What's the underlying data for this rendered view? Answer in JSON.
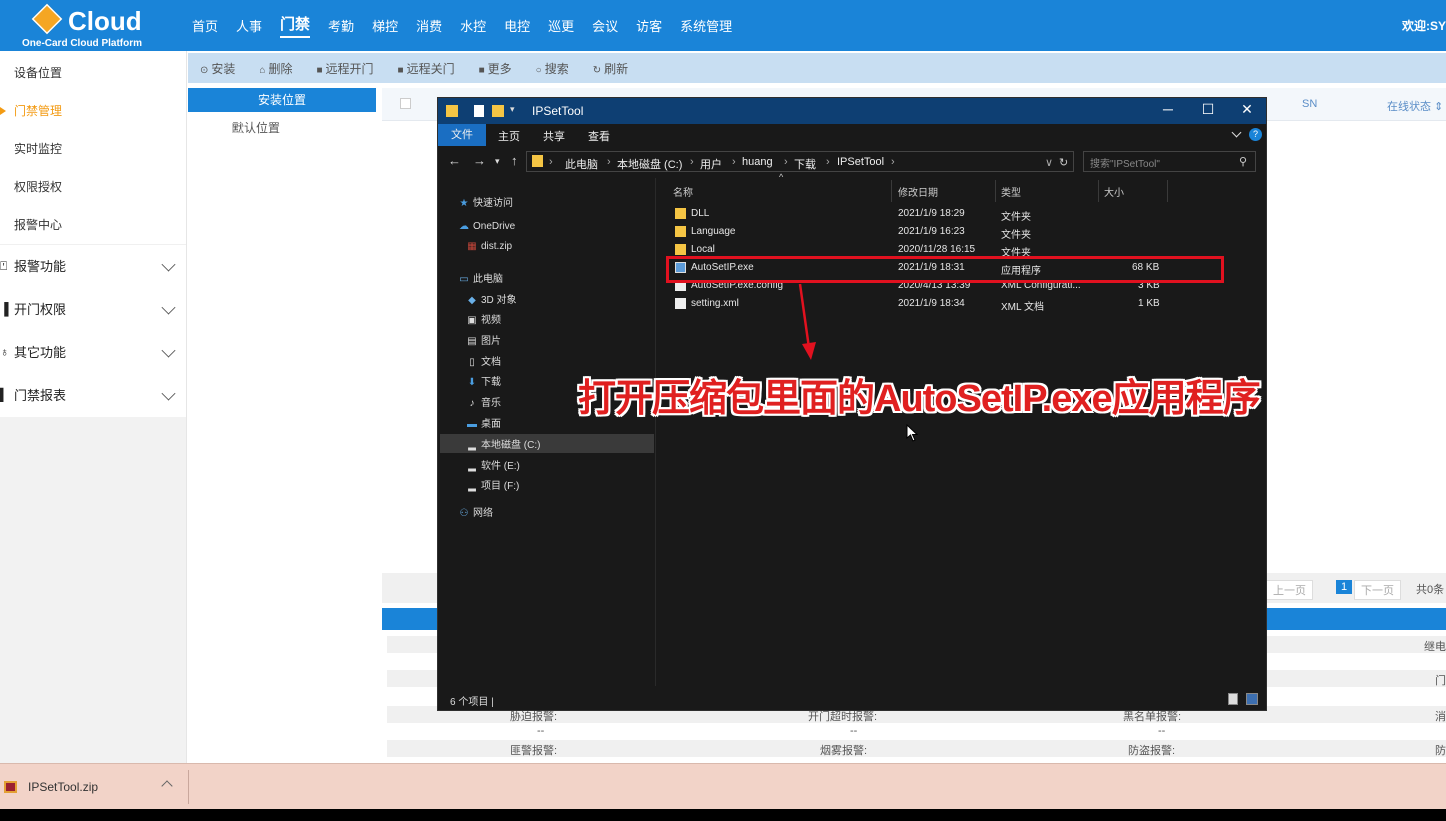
{
  "brand": {
    "name": "Cloud",
    "subtitle": "One-Card Cloud Platform"
  },
  "topnav": [
    "首页",
    "人事",
    "门禁",
    "考勤",
    "梯控",
    "消费",
    "水控",
    "电控",
    "巡更",
    "会议",
    "访客",
    "系统管理"
  ],
  "topnav_active": "门禁",
  "welcome": "欢迎:SY",
  "sidebar": {
    "items": [
      "设备位置",
      "门禁管理",
      "实时监控",
      "权限授权",
      "报警中心"
    ],
    "active": "门禁管理",
    "groups": [
      "报警功能",
      "开门权限",
      "其它功能",
      "门禁报表"
    ]
  },
  "toolbar": [
    "安装",
    "删除",
    "远程开门",
    "远程关门",
    "更多",
    "搜索",
    "刷新"
  ],
  "tree": {
    "header": "安装位置",
    "node": "默认位置"
  },
  "grid": {
    "col_sn": "SN",
    "col_online": "在线状态"
  },
  "pager": {
    "prev": "上一页",
    "current": "1",
    "next": "下一页",
    "total": "共0条"
  },
  "details": {
    "row3": [
      "胁迫报警:",
      "开门超时报警:",
      "黑名单报警:",
      "消"
    ],
    "row4": [
      "--",
      "--",
      "--"
    ],
    "row5": [
      "匪警报警:",
      "烟雾报警:",
      "防盗报警:",
      "防"
    ],
    "right1": "继电",
    "right2": "门"
  },
  "taskbar": {
    "file": "IPSetTool.zip"
  },
  "explorer": {
    "title": "IPSetTool",
    "ribbon": [
      "文件",
      "主页",
      "共享",
      "查看"
    ],
    "breadcrumb": [
      "此电脑",
      "本地磁盘 (C:)",
      "用户",
      "huang",
      "下载",
      "IPSetTool"
    ],
    "search_placeholder": "搜索\"IPSetTool\"",
    "nav": [
      {
        "label": "快速访问",
        "icon": "star-icon"
      },
      {
        "label": "OneDrive",
        "icon": "cloud-icon"
      },
      {
        "label": "dist.zip",
        "icon": "zip-icon"
      },
      {
        "label": "此电脑",
        "icon": "pc-icon"
      },
      {
        "label": "3D 对象",
        "icon": "cube-icon"
      },
      {
        "label": "视频",
        "icon": "video-icon"
      },
      {
        "label": "图片",
        "icon": "picture-icon"
      },
      {
        "label": "文档",
        "icon": "document-icon"
      },
      {
        "label": "下载",
        "icon": "download-icon"
      },
      {
        "label": "音乐",
        "icon": "music-icon"
      },
      {
        "label": "桌面",
        "icon": "desktop-icon"
      },
      {
        "label": "本地磁盘 (C:)",
        "icon": "drive-icon"
      },
      {
        "label": "软件 (E:)",
        "icon": "drive-icon"
      },
      {
        "label": "项目 (F:)",
        "icon": "drive-icon"
      },
      {
        "label": "网络",
        "icon": "network-icon"
      }
    ],
    "columns": [
      "名称",
      "修改日期",
      "类型",
      "大小"
    ],
    "files": [
      {
        "name": "DLL",
        "date": "2021/1/9 18:29",
        "type": "文件夹",
        "size": "",
        "icon": "folder-icon"
      },
      {
        "name": "Language",
        "date": "2021/1/9 16:23",
        "type": "文件夹",
        "size": "",
        "icon": "folder-icon"
      },
      {
        "name": "Local",
        "date": "2020/11/28 16:15",
        "type": "文件夹",
        "size": "",
        "icon": "folder-icon"
      },
      {
        "name": "AutoSetIP.exe",
        "date": "2021/1/9 18:31",
        "type": "应用程序",
        "size": "68 KB",
        "icon": "exe-icon"
      },
      {
        "name": "AutoSetIP.exe.config",
        "date": "2020/4/13 13:39",
        "type": "XML Configurati...",
        "size": "3 KB",
        "icon": "config-icon"
      },
      {
        "name": "setting.xml",
        "date": "2021/1/9 18:34",
        "type": "XML 文档",
        "size": "1 KB",
        "icon": "xml-icon"
      }
    ],
    "status": "6 个项目  |"
  },
  "annotation": "打开压缩包里面的AutoSetIP.exe应用程序",
  "colors": {
    "primary": "#1a84d8",
    "accent": "#f39b13",
    "highlight": "#e1111f"
  }
}
